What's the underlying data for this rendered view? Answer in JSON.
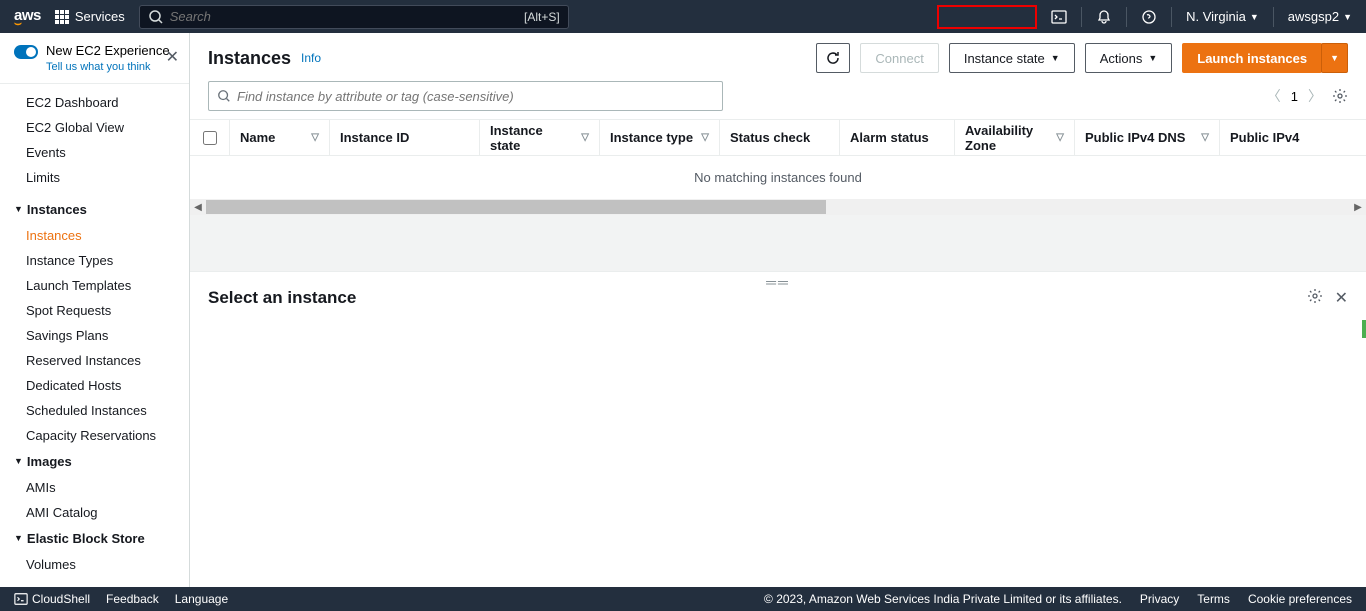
{
  "topnav": {
    "services_label": "Services",
    "search_placeholder": "Search",
    "search_shortcut": "[Alt+S]",
    "region": "N. Virginia",
    "account": "awsgsp2"
  },
  "sidebar": {
    "new_experience_title": "New EC2 Experience",
    "new_experience_feedback": "Tell us what you think",
    "links_top": [
      "EC2 Dashboard",
      "EC2 Global View",
      "Events",
      "Limits"
    ],
    "groups": [
      {
        "label": "Instances",
        "items": [
          "Instances",
          "Instance Types",
          "Launch Templates",
          "Spot Requests",
          "Savings Plans",
          "Reserved Instances",
          "Dedicated Hosts",
          "Scheduled Instances",
          "Capacity Reservations"
        ],
        "activeIndex": 0
      },
      {
        "label": "Images",
        "items": [
          "AMIs",
          "AMI Catalog"
        ]
      },
      {
        "label": "Elastic Block Store",
        "items": [
          "Volumes"
        ]
      }
    ]
  },
  "page": {
    "title": "Instances",
    "info_label": "Info",
    "buttons": {
      "connect": "Connect",
      "instance_state": "Instance state",
      "actions": "Actions",
      "launch": "Launch instances"
    },
    "filter_placeholder": "Find instance by attribute or tag (case-sensitive)",
    "page_number": "1",
    "columns": [
      "Name",
      "Instance ID",
      "Instance state",
      "Instance type",
      "Status check",
      "Alarm status",
      "Availability Zone",
      "Public IPv4 DNS",
      "Public IPv4"
    ],
    "column_sortable": [
      true,
      false,
      true,
      true,
      false,
      false,
      true,
      true,
      false
    ],
    "no_match": "No matching instances found",
    "detail_title": "Select an instance"
  },
  "footer": {
    "cloudshell": "CloudShell",
    "feedback": "Feedback",
    "language": "Language",
    "copyright": "© 2023, Amazon Web Services India Private Limited or its affiliates.",
    "links": [
      "Privacy",
      "Terms",
      "Cookie preferences"
    ]
  }
}
